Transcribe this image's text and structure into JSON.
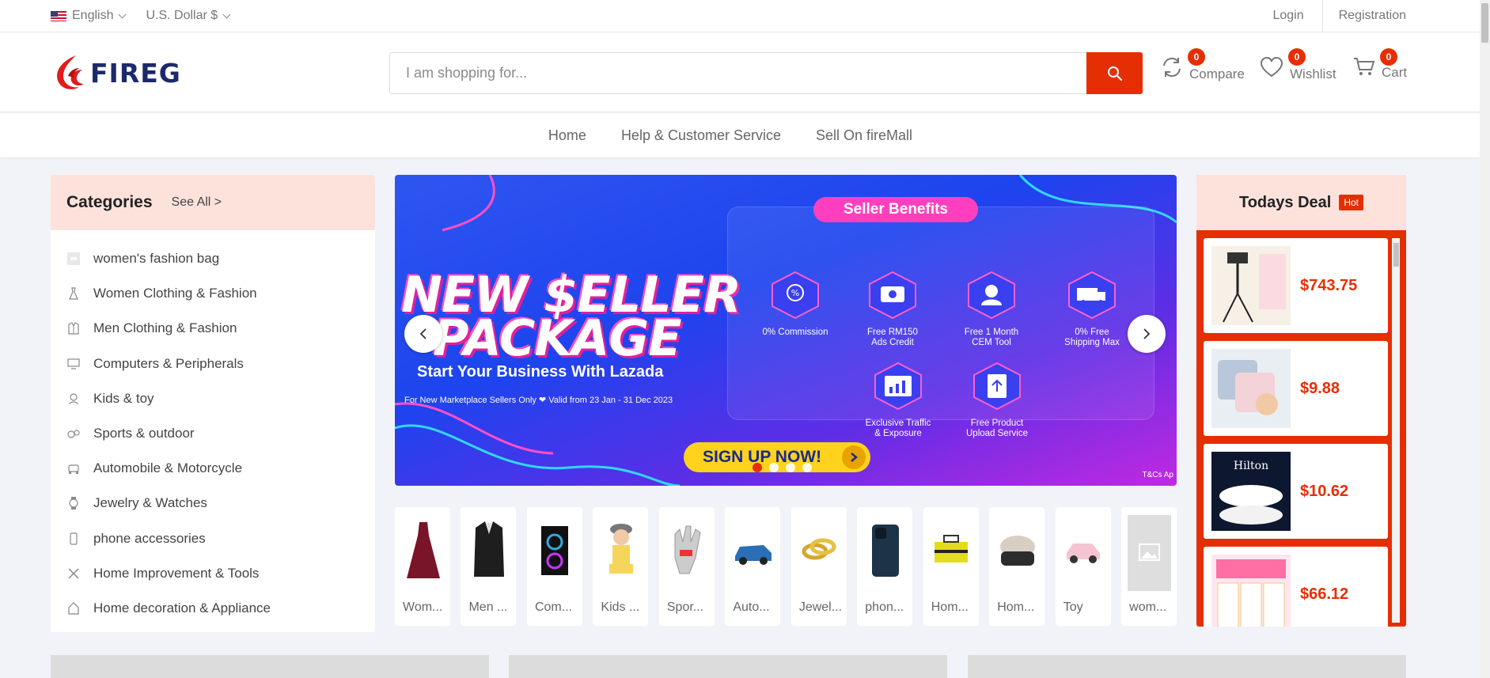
{
  "topbar": {
    "language": "English",
    "currency": "U.S. Dollar $",
    "login": "Login",
    "registration": "Registration"
  },
  "header": {
    "logo_text": "FIREG",
    "search_placeholder": "I am shopping for...",
    "compare_label": "Compare",
    "compare_count": "0",
    "wishlist_label": "Wishlist",
    "wishlist_count": "0",
    "cart_label": "Cart",
    "cart_count": "0"
  },
  "nav": {
    "items": [
      "Home",
      "Help & Customer Service",
      "Sell On fireMall"
    ]
  },
  "categories": {
    "title": "Categories",
    "see_all": "See All >",
    "items": [
      {
        "label": "women's fashion bag",
        "icon": "image-placeholder-icon"
      },
      {
        "label": "Women Clothing & Fashion",
        "icon": "dress-icon"
      },
      {
        "label": "Men Clothing & Fashion",
        "icon": "suit-icon"
      },
      {
        "label": "Computers & Peripherals",
        "icon": "monitor-icon"
      },
      {
        "label": "Kids & toy",
        "icon": "toy-icon"
      },
      {
        "label": "Sports & outdoor",
        "icon": "sports-icon"
      },
      {
        "label": "Automobile & Motorcycle",
        "icon": "car-icon"
      },
      {
        "label": "Jewelry & Watches",
        "icon": "watch-icon"
      },
      {
        "label": "phone accessories",
        "icon": "phone-icon"
      },
      {
        "label": "Home Improvement & Tools",
        "icon": "tools-icon"
      },
      {
        "label": "Home decoration & Appliance",
        "icon": "appliance-icon"
      }
    ]
  },
  "banner": {
    "headline_1": "NEW $ELLER",
    "headline_2": "PACKAGE",
    "subheadline": "Start Your Business With Lazada",
    "fine_print": "For New Marketplace Sellers Only  ❤  Valid from 23 Jan - 31 Dec 2023",
    "benefits_title": "Seller Benefits",
    "benefits": [
      "0% Commission",
      "Free RM150\nAds Credit",
      "Free 1 Month\nCEM Tool",
      "0% Free\nShipping Max",
      "Exclusive Traffic\n& Exposure",
      "Free Product\nUpload Service"
    ],
    "cta": "SIGN UP NOW!",
    "tcs": "T&Cs Ap",
    "slide_count": 4,
    "active_slide": 1
  },
  "product_strip": {
    "items": [
      "Wom...",
      "Men ...",
      "Com...",
      "Kids ...",
      "Spor...",
      "Auto...",
      "Jewel...",
      "phon...",
      "Hom...",
      "Hom...",
      "Toy",
      "wom..."
    ]
  },
  "todays_deal": {
    "title": "Todays Deal",
    "badge": "Hot",
    "items": [
      {
        "price": "$743.75"
      },
      {
        "price": "$9.88"
      },
      {
        "price": "$10.62"
      },
      {
        "price": "$66.12"
      }
    ]
  },
  "colors": {
    "accent": "#e62e04",
    "panel_header": "#fde2dc",
    "logo_navy": "#1c2a6b"
  }
}
